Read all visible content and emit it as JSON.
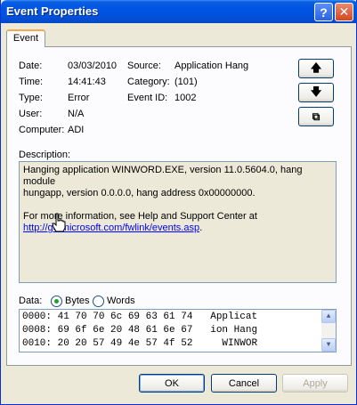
{
  "window": {
    "title": "Event Properties",
    "help": "?",
    "close": "✕"
  },
  "tab": {
    "label": "Event"
  },
  "fields": {
    "date_label": "Date:",
    "date_value": "03/03/2010",
    "source_label": "Source:",
    "source_value": "Application Hang",
    "time_label": "Time:",
    "time_value": "14:41:43",
    "category_label": "Category:",
    "category_value": "(101)",
    "type_label": "Type:",
    "type_value": "Error",
    "eventid_label": "Event ID:",
    "eventid_value": "1002",
    "user_label": "User:",
    "user_value": "N/A",
    "computer_label": "Computer:",
    "computer_value": "ADI"
  },
  "nav": {
    "up": "🡅",
    "down": "🡇",
    "copy": "⧉"
  },
  "description": {
    "label": "Description:",
    "line1": "Hanging application WINWORD.EXE, version 11.0.5604.0, hang module",
    "line2": "hungapp, version 0.0.0.0, hang address 0x00000000.",
    "line3": "For more information, see Help and Support Center at",
    "link": "http://go.microsoft.com/fwlink/events.asp",
    "link_suffix": "."
  },
  "data": {
    "label": "Data:",
    "bytes_label": "Bytes",
    "words_label": "Words",
    "selected": "Bytes",
    "rows": [
      "0000: 41 70 70 6c 69 63 61 74   Applicat",
      "0008: 69 6f 6e 20 48 61 6e 67   ion Hang",
      "0010: 20 20 57 49 4e 57 4f 52     WINWOR"
    ]
  },
  "buttons": {
    "ok": "OK",
    "cancel": "Cancel",
    "apply": "Apply"
  }
}
